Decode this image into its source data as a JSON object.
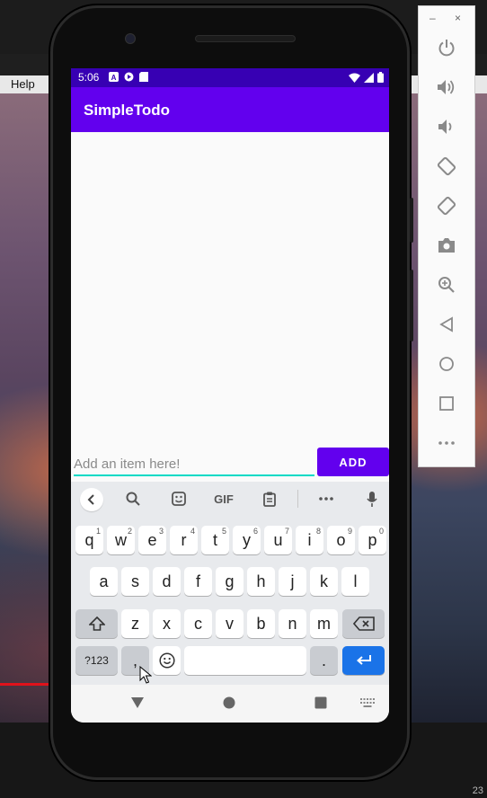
{
  "desktop": {
    "menu_help": "Help",
    "like_count": "23"
  },
  "phone": {
    "status": {
      "time": "5:06",
      "icons": [
        "a-badge-icon",
        "play-protect-icon",
        "sd-card-icon",
        "wifi-icon",
        "signal-icon",
        "battery-icon"
      ]
    },
    "app": {
      "title": "SimpleTodo",
      "accent_color": "#6200ee",
      "status_color": "#3700b3",
      "underline_color": "#03dac5"
    },
    "input": {
      "placeholder": "Add an item here!",
      "value": ""
    },
    "add_button_label": "ADD",
    "keyboard": {
      "toolbar": {
        "gif_label": "GIF"
      },
      "row1": [
        {
          "key": "q",
          "hint": "1"
        },
        {
          "key": "w",
          "hint": "2"
        },
        {
          "key": "e",
          "hint": "3"
        },
        {
          "key": "r",
          "hint": "4"
        },
        {
          "key": "t",
          "hint": "5"
        },
        {
          "key": "y",
          "hint": "6"
        },
        {
          "key": "u",
          "hint": "7"
        },
        {
          "key": "i",
          "hint": "8"
        },
        {
          "key": "o",
          "hint": "9"
        },
        {
          "key": "p",
          "hint": "0"
        }
      ],
      "row2": [
        "a",
        "s",
        "d",
        "f",
        "g",
        "h",
        "j",
        "k",
        "l"
      ],
      "row3": [
        "z",
        "x",
        "c",
        "v",
        "b",
        "n",
        "m"
      ],
      "row4": {
        "symbols": "?123",
        "comma": ",",
        "period": "."
      }
    }
  },
  "emulator_panel": {
    "minimize": "–",
    "close": "×",
    "buttons": [
      "power-icon",
      "volume-up-icon",
      "volume-down-icon",
      "rotate-left-icon",
      "rotate-right-icon",
      "camera-icon",
      "zoom-icon",
      "back-icon",
      "home-icon",
      "overview-icon",
      "more-icon"
    ]
  }
}
